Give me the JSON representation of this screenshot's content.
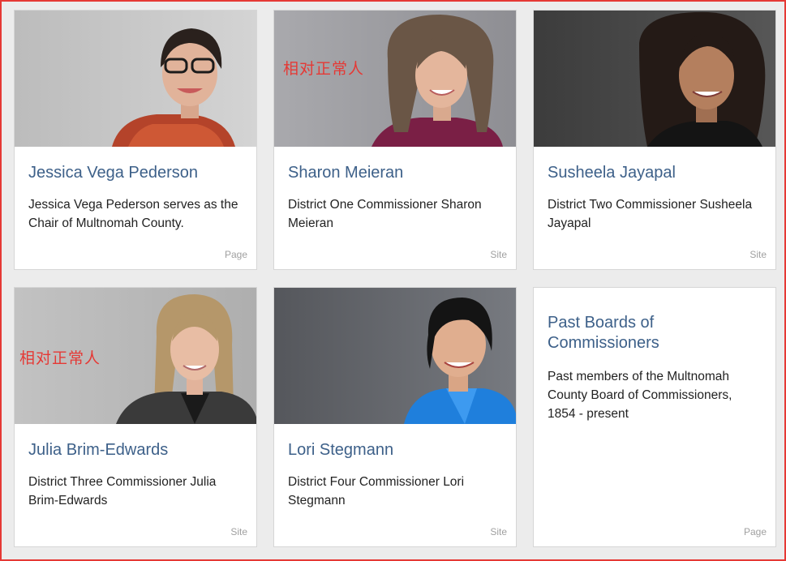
{
  "cards": [
    {
      "name": "Jessica Vega Pederson",
      "description": "Jessica Vega Pederson serves as the Chair of Multnomah County.",
      "type": "Page",
      "overlay": ""
    },
    {
      "name": "Sharon Meieran",
      "description": "District One Commissioner Sharon Meieran",
      "type": "Site",
      "overlay": "相对正常人"
    },
    {
      "name": "Susheela Jayapal",
      "description": "District Two Commissioner Susheela Jayapal",
      "type": "Site",
      "overlay": ""
    },
    {
      "name": "Julia Brim-Edwards",
      "description": "District Three Commissioner Julia Brim-Edwards",
      "type": "Site",
      "overlay": "相对正常人"
    },
    {
      "name": "Lori Stegmann",
      "description": "District Four Commissioner Lori Stegmann",
      "type": "Site",
      "overlay": ""
    },
    {
      "name": "Past Boards of Commissioners",
      "description": "Past members of the Multnomah County Board of Commissioners, 1854 - present",
      "type": "Page",
      "overlay": ""
    }
  ],
  "colors": {
    "title": "#3d6089",
    "overlay": "#e53935",
    "border_highlight": "#e53935"
  }
}
